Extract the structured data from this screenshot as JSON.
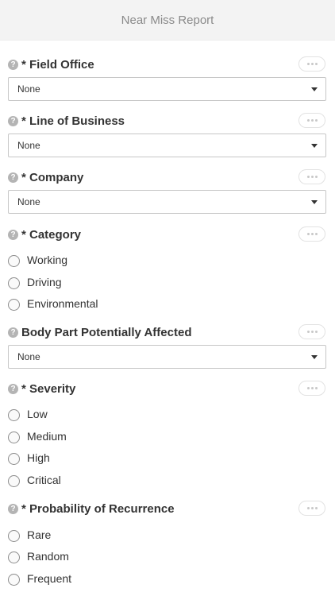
{
  "header": {
    "title": "Near Miss Report"
  },
  "icons": {
    "help": "help-icon",
    "more": "more-icon",
    "dropdown": "chevron-down-icon"
  },
  "fields": {
    "field_office": {
      "label": "* Field Office",
      "value": "None"
    },
    "line_of_business": {
      "label": "* Line of Business",
      "value": "None"
    },
    "company": {
      "label": "* Company",
      "value": "None"
    },
    "category": {
      "label": "* Category",
      "options": [
        "Working",
        "Driving",
        "Environmental"
      ]
    },
    "body_part": {
      "label": "Body Part Potentially Affected",
      "value": "None"
    },
    "severity": {
      "label": "* Severity",
      "options": [
        "Low",
        "Medium",
        "High",
        "Critical"
      ]
    },
    "probability": {
      "label": "* Probability of Recurrence",
      "options": [
        "Rare",
        "Random",
        "Frequent"
      ]
    }
  }
}
